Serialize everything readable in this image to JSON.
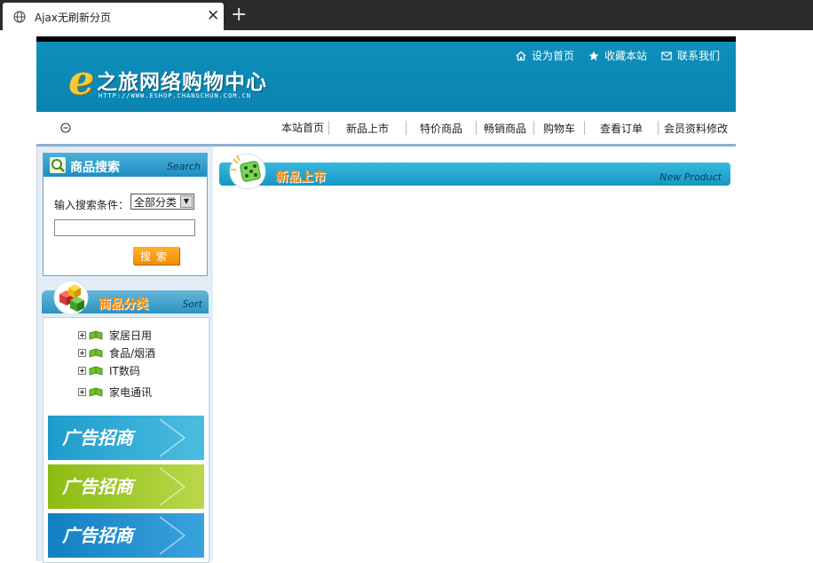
{
  "browser": {
    "tab_title": "Ajax无刷新分页",
    "close_glyph": "✕",
    "newtab_glyph": "+"
  },
  "header": {
    "logo_letter": "e",
    "logo_text": "之旅网络购物中心",
    "logo_url": "HTTP://WWW.ESHOP.CHANGCHUN.COM.CN",
    "links": [
      {
        "label": "设为首页",
        "icon": "home-icon"
      },
      {
        "label": "收藏本站",
        "icon": "star-icon"
      },
      {
        "label": "联系我们",
        "icon": "mail-icon"
      }
    ]
  },
  "nav": {
    "items": [
      "本站首页",
      "新品上市",
      "特价商品",
      "畅销商品",
      "购物车",
      "查看订单",
      "会员资料修改"
    ]
  },
  "search": {
    "title": "商品搜索",
    "title_en": "Search",
    "condition_label": "输入搜索条件：",
    "category_selected": "全部分类",
    "input_value": "",
    "button_label": "搜索"
  },
  "categories": {
    "title": "商品分类",
    "title_en": "Sort",
    "items": [
      "家居日用",
      "食品/烟酒",
      "IT数码",
      "家电通讯"
    ]
  },
  "ads": {
    "items": [
      {
        "label": "广告招商",
        "color": "#2aa6cf"
      },
      {
        "label": "广告招商",
        "color": "#9cc61d"
      },
      {
        "label": "广告招商",
        "color": "#1f8fd0"
      }
    ]
  },
  "new_products": {
    "title": "新品上市",
    "title_en": "New Product"
  },
  "colors": {
    "banner": "#0b84b1",
    "accent_orange": "#ff8a00"
  }
}
